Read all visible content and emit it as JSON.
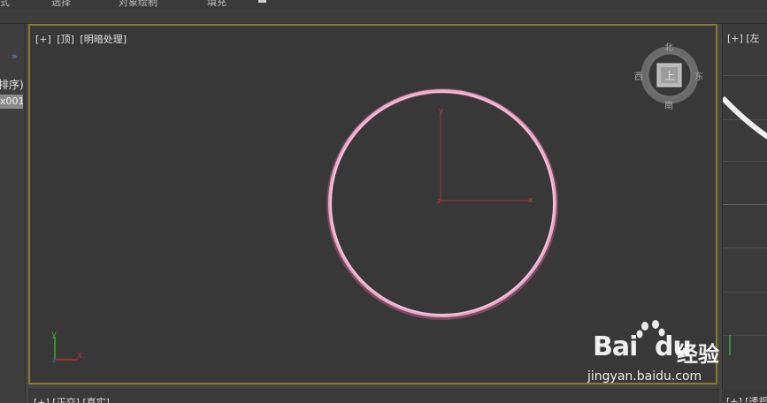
{
  "menubar": {
    "items": [
      "式",
      "选择",
      "对象绘制",
      "填充"
    ]
  },
  "left_panel": {
    "chevron": "»",
    "sort_label": "排序)",
    "object_item": "x001"
  },
  "viewport_top": {
    "label_plus": "[+]",
    "label_view": "[顶]",
    "label_shading": "[明暗处理]",
    "border_color": "#8a7a2e",
    "circle_color": "#e8a8c8",
    "pivot": {
      "y_label": "y",
      "x_label": "x",
      "z_label": "z"
    },
    "viewcube": {
      "north": "北",
      "south": "南",
      "east": "东",
      "west": "西",
      "face": "上"
    },
    "gizmo": {
      "y_label": "y",
      "x_label": "x",
      "z_label": "z"
    }
  },
  "right_panel": {
    "label_plus": "[+]",
    "label_view": "[左"
  },
  "bottom_viewport": {
    "label": "[+] [正交] [真实]"
  },
  "bottom_right": {
    "label": "[+] [透视"
  },
  "watermark": {
    "brand": "Bai",
    "brand_suffix": "du",
    "cn": "经验",
    "url": "jingyan.baidu.com"
  }
}
